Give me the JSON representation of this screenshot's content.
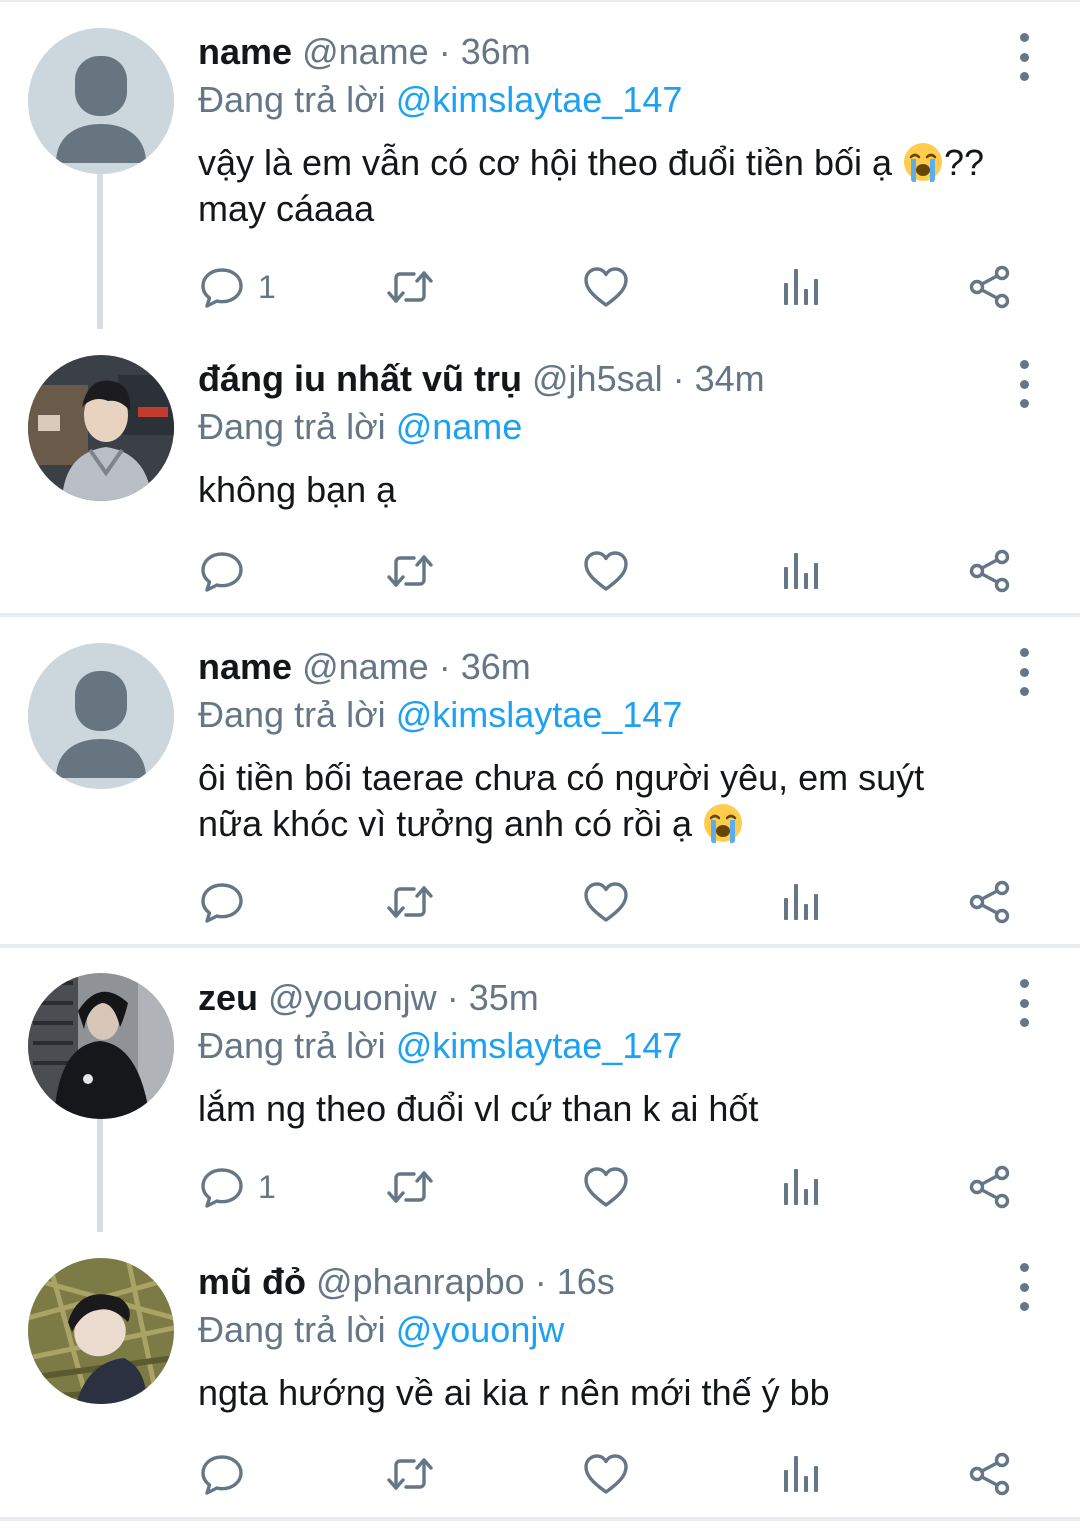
{
  "icons": {
    "reply": "speech-bubble-icon",
    "retweet": "retweet-arrows-icon",
    "like": "heart-icon",
    "stats": "bar-chart-icon",
    "share": "share-nodes-icon",
    "more": "vertical-ellipsis-icon",
    "emoji": "loudly-crying-face"
  },
  "colors": {
    "accent": "#1da1f2",
    "muted": "#657786",
    "divider": "#e6ecf0"
  },
  "tweets": [
    {
      "name": "name",
      "handle": "@name",
      "separator": "·",
      "time": "36m",
      "reply_prefix": "Đang trả lời",
      "reply_to": "@kimslaytae_147",
      "text_before_emoji": "vậy là em vẫn có cơ hội theo đuổi tiền bối ạ ",
      "text_after_emoji": "??",
      "text_line2": "may cáaaa",
      "reply_count": "1"
    },
    {
      "name": "đáng iu nhất vũ trụ",
      "handle": "@jh5sal",
      "separator": "·",
      "time": "34m",
      "reply_prefix": "Đang trả lời",
      "reply_to": "@name",
      "text": "không bạn ạ",
      "reply_count": ""
    },
    {
      "name": "name",
      "handle": "@name",
      "separator": "·",
      "time": "36m",
      "reply_prefix": "Đang trả lời",
      "reply_to": "@kimslaytae_147",
      "text_line1": "ôi tiền bối taerae chưa có người yêu, em suýt",
      "text_line2": "nữa khóc vì tưởng anh có rồi ạ ",
      "reply_count": ""
    },
    {
      "name": "zeu",
      "handle": "@youonjw",
      "separator": "·",
      "time": "35m",
      "reply_prefix": "Đang trả lời",
      "reply_to": "@kimslaytae_147",
      "text": "lắm ng theo đuổi vl cứ than k ai hốt",
      "reply_count": "1"
    },
    {
      "name": "mũ đỏ",
      "handle": "@phanrapbo",
      "separator": "·",
      "time": "16s",
      "reply_prefix": "Đang trả lời",
      "reply_to": "@youonjw",
      "text": "ngta hướng về ai kia r nên mới thế ý bb",
      "reply_count": ""
    }
  ]
}
